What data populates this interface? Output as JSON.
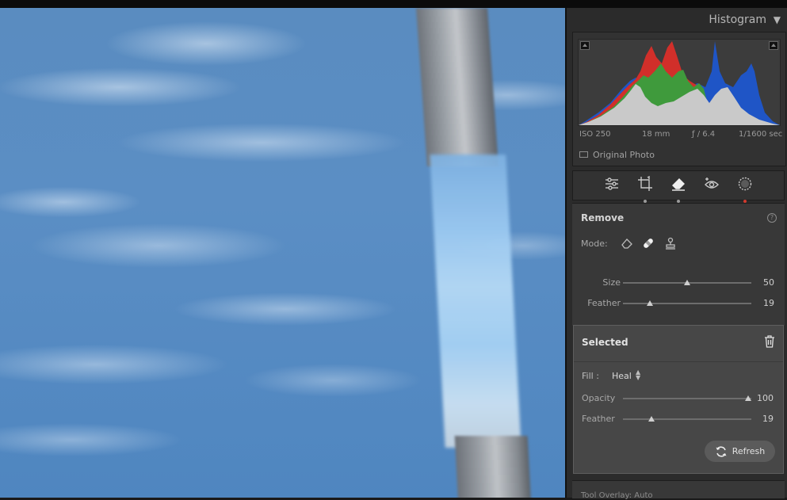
{
  "histogram": {
    "title": "Histogram",
    "toggle_icon": "triangle-down-icon",
    "iso": "ISO 250",
    "focal_length": "18 mm",
    "aperture": "ƒ / 6.4",
    "shutter": "1/1600 sec",
    "original_photo_label": "Original Photo",
    "colors": {
      "red": "#d12f2a",
      "green": "#3f9a3c",
      "blue": "#1f55c6",
      "gray": "#c9c9c9"
    }
  },
  "tools": [
    {
      "name": "edit-sliders-icon"
    },
    {
      "name": "crop-icon"
    },
    {
      "name": "eraser-remove-icon",
      "active": true
    },
    {
      "name": "red-eye-icon"
    },
    {
      "name": "masking-icon"
    }
  ],
  "remove": {
    "title": "Remove",
    "help": "?",
    "mode_label": "Mode:",
    "size_label": "Size",
    "size_value": "50",
    "size_level": 0.5,
    "feather_label": "Feather",
    "feather_value": "19",
    "feather_level": 0.19
  },
  "selected": {
    "title": "Selected",
    "fill_label": "Fill :",
    "fill_value": "Heal",
    "opacity_label": "Opacity",
    "opacity_value": "100",
    "opacity_level": 1.0,
    "feather_label": "Feather",
    "feather_value": "19",
    "feather_level": 0.19,
    "refresh_label": "Refresh"
  },
  "bottom": {
    "text": "Tool Overlay: Auto"
  }
}
